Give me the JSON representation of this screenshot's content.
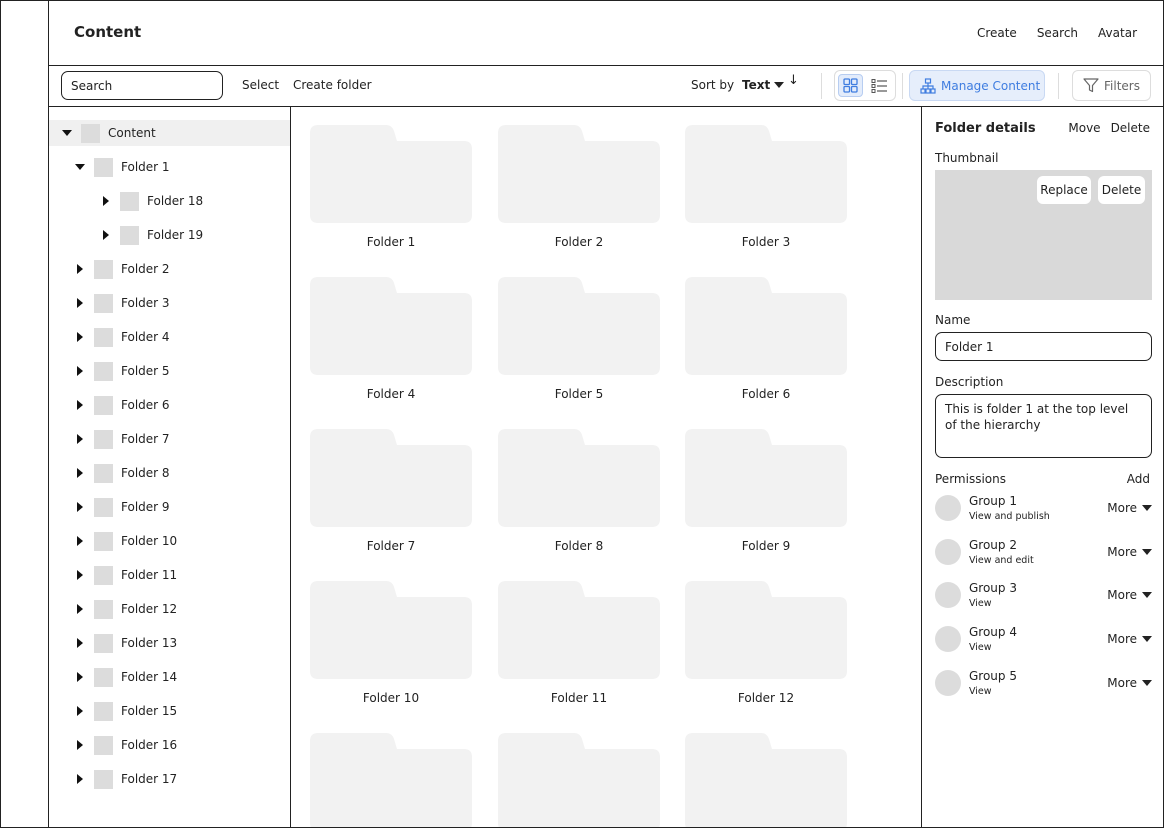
{
  "header": {
    "title": "Content",
    "nav": [
      "Create",
      "Search",
      "Avatar"
    ]
  },
  "toolbar": {
    "search_placeholder": "Search",
    "select_label": "Select",
    "create_folder_label": "Create folder",
    "sort_by_label": "Sort by",
    "sort_value": "Text",
    "sort_direction_glyph": "↓",
    "manage_content_label": "Manage Content",
    "filters_label": "Filters",
    "accent_color": "#3f7de0"
  },
  "tree": {
    "root": "Content",
    "items": [
      {
        "label": "Folder 1",
        "expanded": true
      },
      {
        "label": "Folder 18",
        "expanded": false
      },
      {
        "label": "Folder 19",
        "expanded": false
      },
      {
        "label": "Folder 2",
        "expanded": false
      },
      {
        "label": "Folder 3",
        "expanded": false
      },
      {
        "label": "Folder 4",
        "expanded": false
      },
      {
        "label": "Folder 5",
        "expanded": false
      },
      {
        "label": "Folder 6",
        "expanded": false
      },
      {
        "label": "Folder 7",
        "expanded": false
      },
      {
        "label": "Folder 8",
        "expanded": false
      },
      {
        "label": "Folder 9",
        "expanded": false
      },
      {
        "label": "Folder 10",
        "expanded": false
      },
      {
        "label": "Folder 11",
        "expanded": false
      },
      {
        "label": "Folder 12",
        "expanded": false
      },
      {
        "label": "Folder 13",
        "expanded": false
      },
      {
        "label": "Folder 14",
        "expanded": false
      },
      {
        "label": "Folder 15",
        "expanded": false
      },
      {
        "label": "Folder 16",
        "expanded": false
      },
      {
        "label": "Folder 17",
        "expanded": false
      }
    ]
  },
  "grid": {
    "folders": [
      "Folder 1",
      "Folder 2",
      "Folder 3",
      "Folder 4",
      "Folder 5",
      "Folder 6",
      "Folder 7",
      "Folder 8",
      "Folder 9",
      "Folder 10",
      "Folder 11",
      "Folder 12",
      "",
      "",
      ""
    ]
  },
  "details": {
    "title": "Folder details",
    "move_label": "Move",
    "delete_label": "Delete",
    "thumbnail_label": "Thumbnail",
    "replace_label": "Replace",
    "thumb_delete_label": "Delete",
    "name_label": "Name",
    "name_value": "Folder 1",
    "description_label": "Description",
    "description_value": "This is folder 1 at the top level of the hierarchy",
    "permissions_label": "Permissions",
    "add_label": "Add",
    "permissions": [
      {
        "group": "Group 1",
        "access": "View and publish",
        "more": "More"
      },
      {
        "group": "Group 2",
        "access": "View and edit",
        "more": "More"
      },
      {
        "group": "Group 3",
        "access": "View",
        "more": "More"
      },
      {
        "group": "Group 4",
        "access": "View",
        "more": "More"
      },
      {
        "group": "Group 5",
        "access": "View",
        "more": "More"
      }
    ]
  }
}
